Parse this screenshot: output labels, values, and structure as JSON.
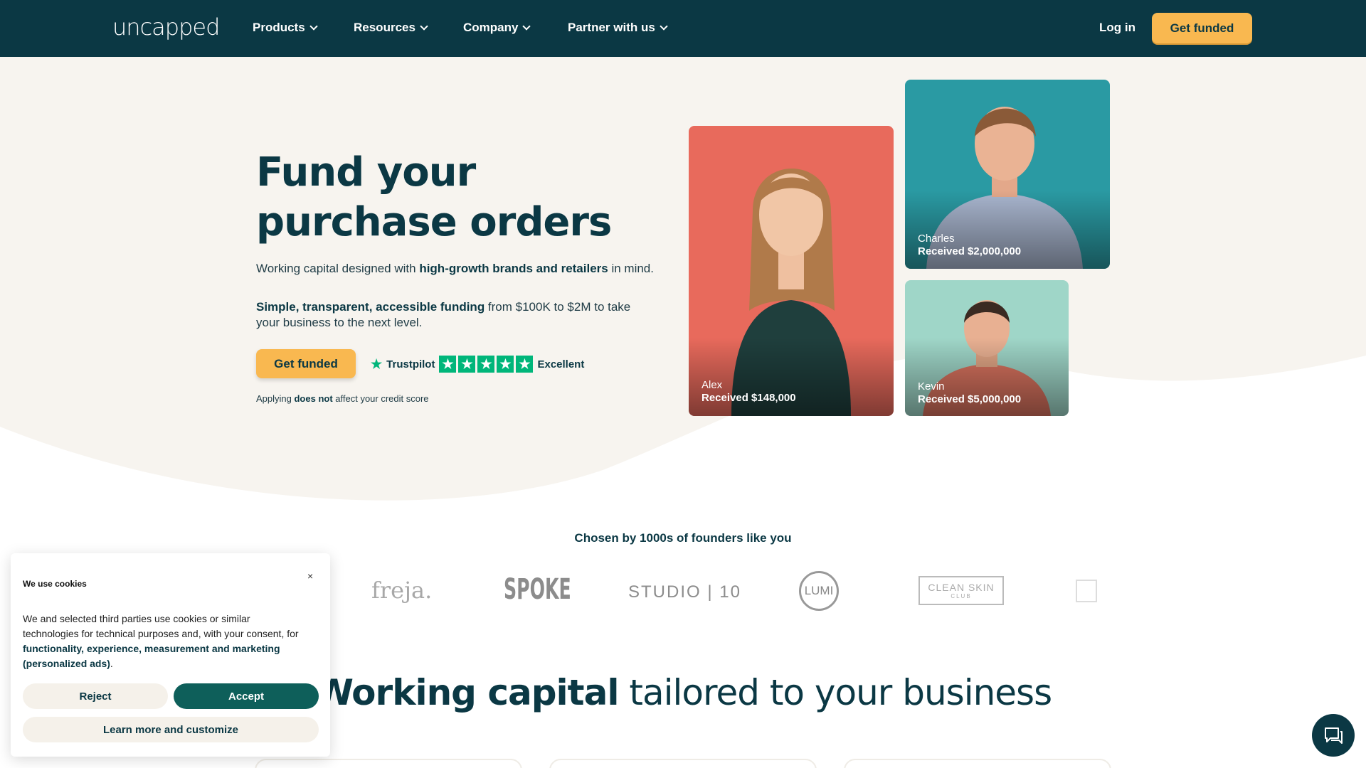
{
  "nav": {
    "logo": "uncapped",
    "items": [
      "Products",
      "Resources",
      "Company",
      "Partner with us"
    ],
    "login": "Log in",
    "cta": "Get funded"
  },
  "hero": {
    "title_line1": "Fund your",
    "title_line2": "purchase orders",
    "p1_a": "Working capital designed with ",
    "p1_b": "high-growth brands and retailers",
    "p1_c": " in mind.",
    "p2_a": "Simple, transparent, accessible funding",
    "p2_b": " from $100K to $2M to take your business to the next level.",
    "cta": "Get funded",
    "trustpilot": "Trustpilot",
    "trustpilot_rating": "Excellent",
    "credit_a": "Applying ",
    "credit_b": "does not",
    "credit_c": " affect your credit score"
  },
  "testimonials": [
    {
      "name": "Alex",
      "amount": "Received $148,000",
      "color": "#e86a5c"
    },
    {
      "name": "Charles",
      "amount": "Received $2,000,000",
      "color": "#2a9aa3"
    },
    {
      "name": "Kevin",
      "amount": "Received $5,000,000",
      "color": "#9fd6c8"
    }
  ],
  "social_proof": {
    "heading": "Chosen by 1000s of founders like you",
    "brands": [
      "freja.",
      "SPOKE",
      "STUDIO | 10",
      "LUMI",
      "CLEAN SKIN",
      "CLUB"
    ]
  },
  "section2": {
    "title_bold": "Working capital",
    "title_rest": " tailored to your business"
  },
  "cookie": {
    "title": "We use cookies",
    "close": "×",
    "text_a": "We and selected third parties use cookies or similar technologies for technical purposes and, with your consent, for ",
    "text_b": "functionality, experience, measurement and marketing (personalized ads)",
    "text_c": ".",
    "reject": "Reject",
    "accept": "Accept",
    "learn": "Learn more and customize"
  },
  "colors": {
    "brand_dark": "#0b3844",
    "accent": "#f9b850",
    "hero_bg": "#f7f4ef",
    "accept": "#0e5f5a",
    "trustpilot_green": "#00b67a"
  },
  "icons": [
    "chevron-down-icon",
    "star-icon",
    "close-icon",
    "chat-icon"
  ]
}
